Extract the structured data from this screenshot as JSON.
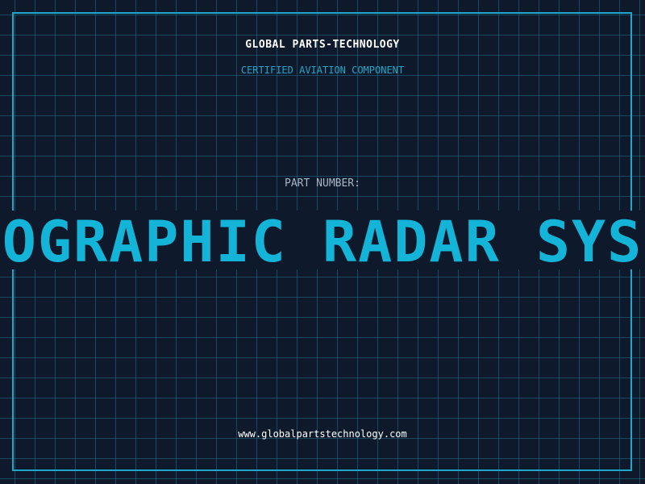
{
  "header": {
    "company_name": "GLOBAL PARTS-TECHNOLOGY",
    "tagline": "CERTIFIED AVIATION COMPONENT"
  },
  "part": {
    "label": "PART NUMBER:",
    "visible_value": "OGRAPHIC RADAR SYS"
  },
  "footer": {
    "website": "www.globalpartstechnology.com"
  },
  "colors": {
    "background": "#0e1a2b",
    "accent": "#1fa6c9",
    "part_number": "#14b4d8",
    "label": "#a9b6c4",
    "text": "#ffffff"
  }
}
